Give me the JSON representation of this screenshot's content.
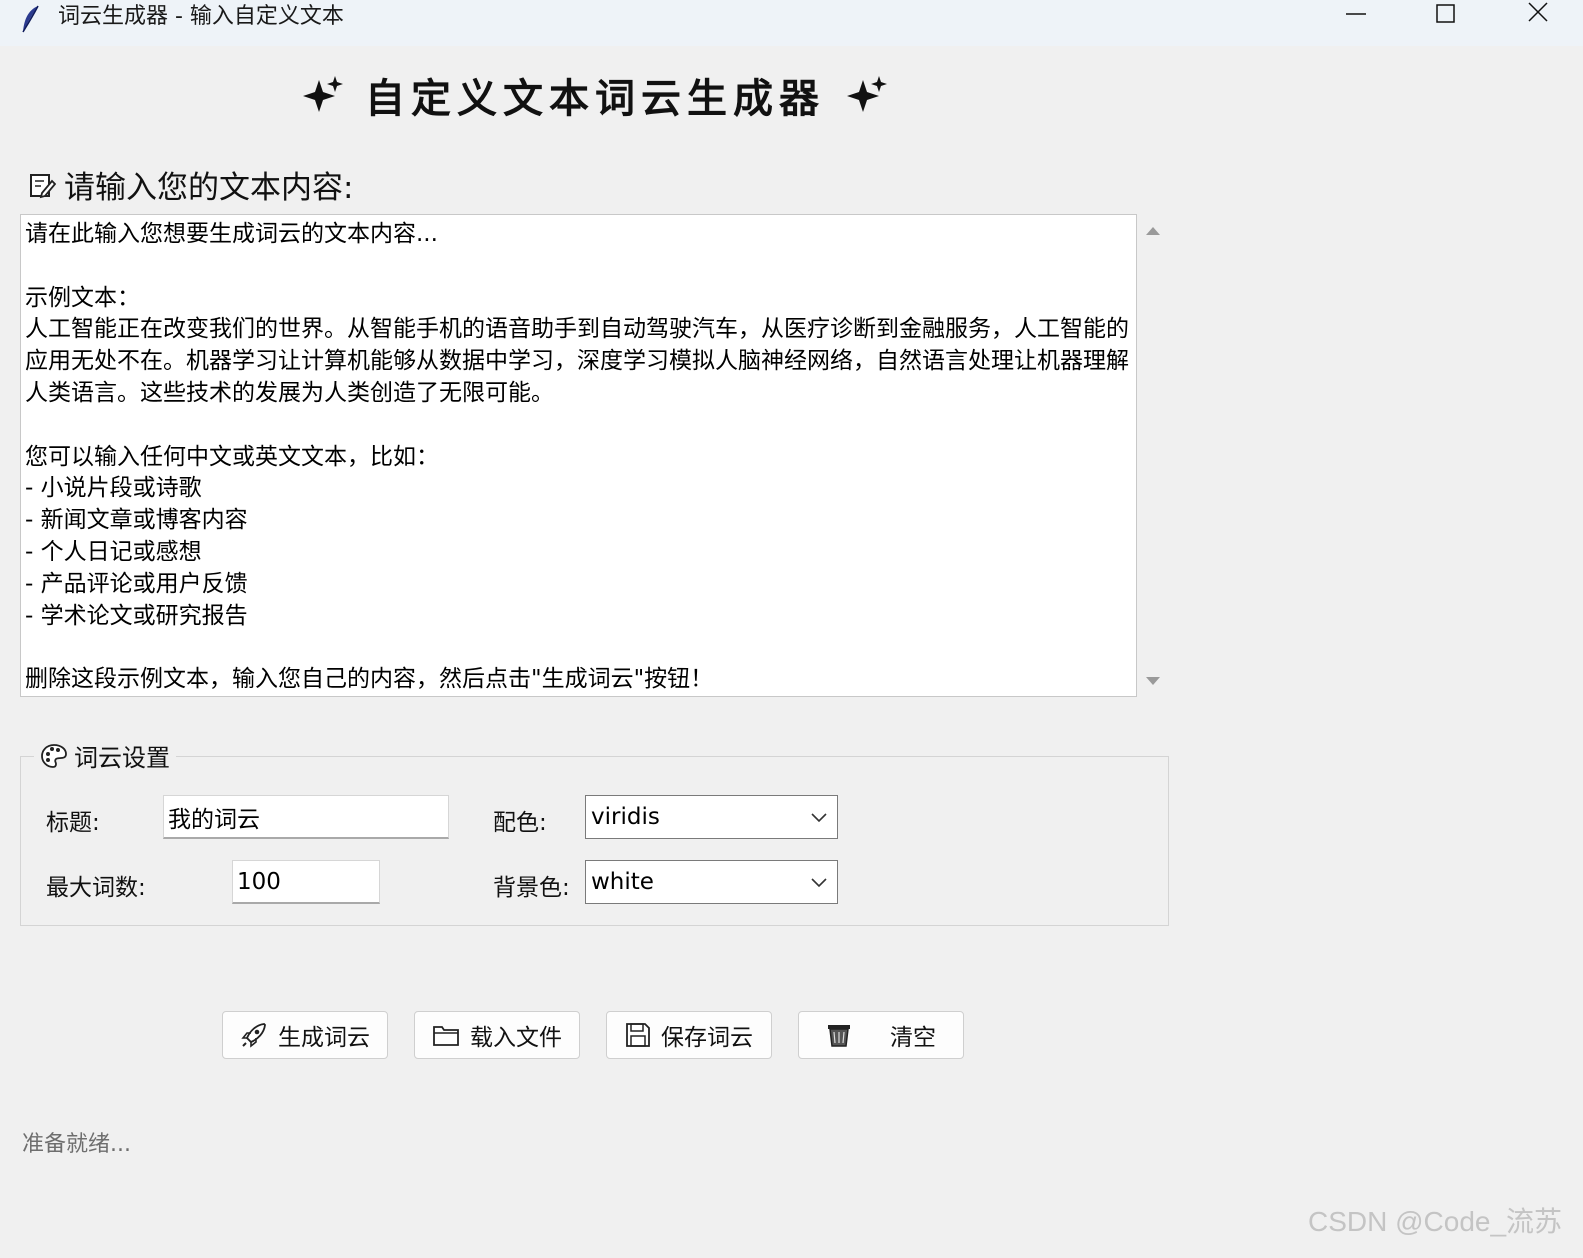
{
  "window": {
    "title": "词云生成器 - 输入自定义文本",
    "icons": [
      "feather-icon",
      "minimize-icon",
      "maximize-icon",
      "close-icon"
    ]
  },
  "header": {
    "title": "自定义文本词云生成器",
    "icons": [
      "sparkle-icon",
      "sparkle-icon"
    ]
  },
  "input_section": {
    "label": "请输入您的文本内容:",
    "icon": "memo-icon",
    "text": "请在此输入您想要生成词云的文本内容...\n\n示例文本：\n人工智能正在改变我们的世界。从智能手机的语音助手到自动驾驶汽车，从医疗诊断到金融服务，人工智能的应用无处不在。机器学习让计算机能够从数据中学习，深度学习模拟人脑神经网络，自然语言处理让机器理解人类语言。这些技术的发展为人类创造了无限可能。\n\n您可以输入任何中文或英文文本，比如：\n- 小说片段或诗歌\n- 新闻文章或博客内容\n- 个人日记或感想\n- 产品评论或用户反馈\n- 学术论文或研究报告\n\n删除这段示例文本，输入您自己的内容，然后点击\"生成词云\"按钮！"
  },
  "settings": {
    "legend": "词云设置",
    "icon": "palette-icon",
    "title_label": "标题:",
    "title_value": "我的词云",
    "max_words_label": "最大词数:",
    "max_words_value": "100",
    "colormap_label": "配色:",
    "colormap_value": "viridis",
    "background_label": "背景色:",
    "background_value": "white"
  },
  "buttons": {
    "generate": "生成词云",
    "load": "载入文件",
    "save": "保存词云",
    "clear": "清空",
    "icons": [
      "rocket-icon",
      "folder-icon",
      "floppy-disk-icon",
      "wastebasket-icon"
    ]
  },
  "status": "准备就绪...",
  "watermark": "CSDN @Code_流苏"
}
